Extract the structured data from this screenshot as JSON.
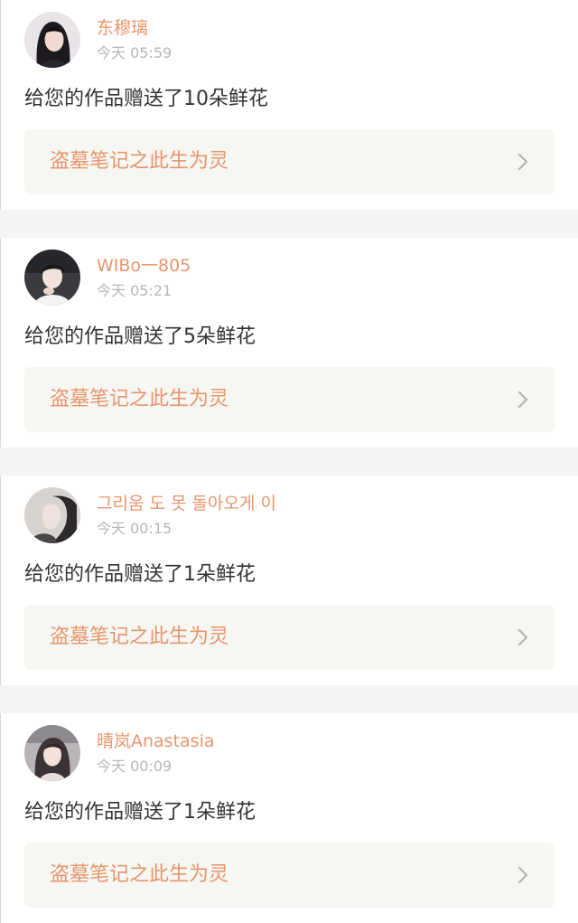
{
  "notifications": [
    {
      "user": "东穆璃",
      "time": "今天 05:59",
      "message": "给您的作品赠送了10朵鲜花",
      "work_title": "盗墓笔记之此生为灵",
      "avatar_icon": "avatar-girl-dark-hair"
    },
    {
      "user": "WIBo一805",
      "time": "今天 05:21",
      "message": "给您的作品赠送了5朵鲜花",
      "work_title": "盗墓笔记之此生为灵",
      "avatar_icon": "avatar-boy-light"
    },
    {
      "user": "그리움 도 못 돌아오게 이",
      "time": "今天 00:15",
      "message": "给您的作品赠送了1朵鲜花",
      "work_title": "盗墓笔记之此生为灵",
      "avatar_icon": "avatar-profile-grey"
    },
    {
      "user": "晴岚Anastasia",
      "time": "今天 00:09",
      "message": "给您的作品赠送了1朵鲜花",
      "work_title": "盗墓笔记之此生为灵",
      "avatar_icon": "avatar-girl-light"
    }
  ],
  "colors": {
    "accent": "#e8956b",
    "meta": "#b6b6b6",
    "text": "#333333",
    "link_bg": "#f6f6f2",
    "separator": "#f4f4f4"
  }
}
